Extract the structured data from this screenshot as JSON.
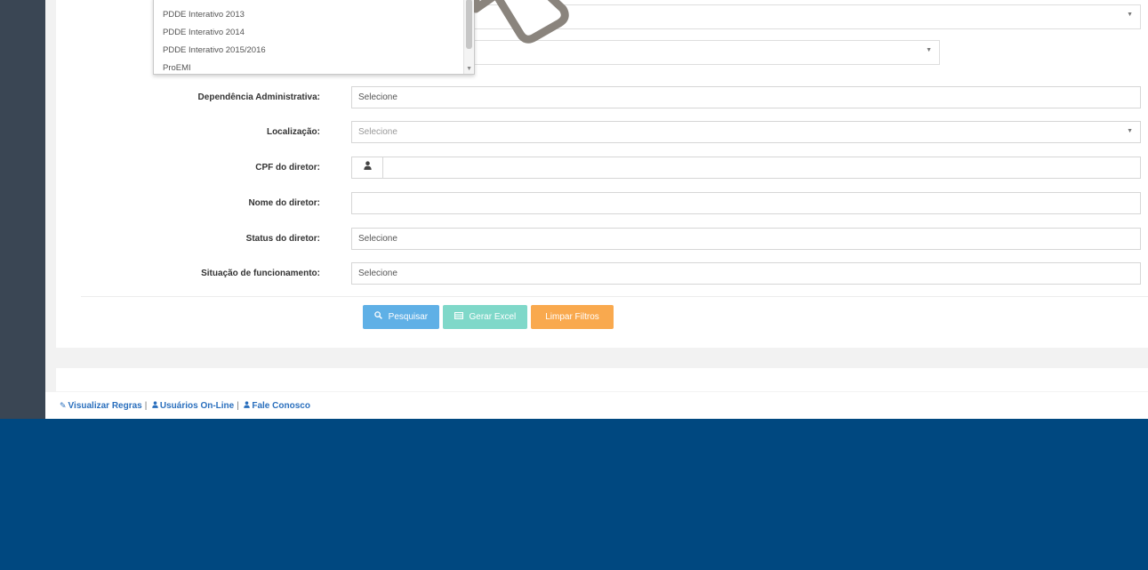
{
  "dropdown": {
    "items": [
      "PDDE Interativo 2013",
      "PDDE Interativo 2014",
      "PDDE Interativo 2015/2016",
      "ProEMI"
    ]
  },
  "form": {
    "dependencia": {
      "label": "Dependência Administrativa:",
      "value": "Selecione"
    },
    "localizacao": {
      "label": "Localização:",
      "value": "Selecione"
    },
    "cpf": {
      "label": "CPF do diretor:",
      "value": ""
    },
    "nome": {
      "label": "Nome do diretor:",
      "value": ""
    },
    "status": {
      "label": "Status do diretor:",
      "value": "Selecione"
    },
    "situacao": {
      "label": "Situação de funcionamento:",
      "value": "Selecione"
    }
  },
  "buttons": {
    "pesquisar": "Pesquisar",
    "gerar_excel": "Gerar Excel",
    "limpar": "Limpar Filtros"
  },
  "footer": {
    "regras": "Visualizar Regras",
    "usuarios": "Usuários On-Line",
    "fale": "Fale Conosco",
    "separator": "|"
  },
  "icons": {
    "user": "user-icon",
    "search": "search-icon",
    "excel": "table-icon",
    "rules": "pencil-icon"
  },
  "colors": {
    "page_background": "#004880",
    "sidebar": "#3a4654",
    "btn_pesquisar": "#5fb0e6",
    "btn_excel": "#7fd8c9",
    "btn_limpar": "#f9a94e",
    "link": "#2a6fbd"
  }
}
